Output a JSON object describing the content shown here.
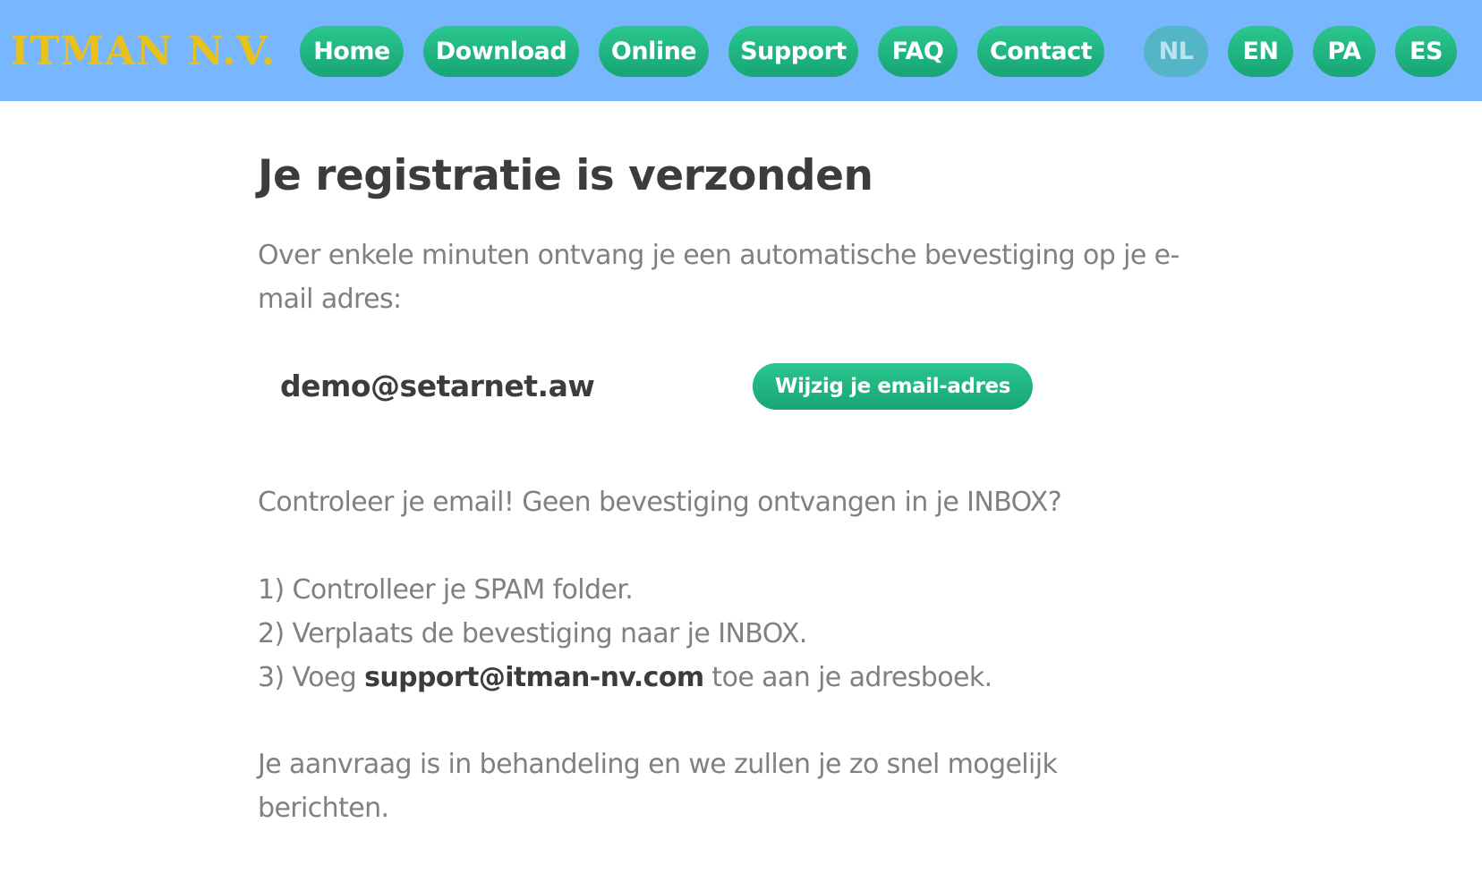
{
  "header": {
    "logo": "ITMAN N.V.",
    "nav": [
      {
        "label": "Home"
      },
      {
        "label": "Download"
      },
      {
        "label": "Online"
      },
      {
        "label": "Support"
      },
      {
        "label": "FAQ"
      },
      {
        "label": "Contact"
      }
    ],
    "languages": [
      {
        "label": "NL",
        "active": true
      },
      {
        "label": "EN",
        "active": false
      },
      {
        "label": "PA",
        "active": false
      },
      {
        "label": "ES",
        "active": false
      }
    ]
  },
  "main": {
    "title": "Je registratie is verzonden",
    "intro": "Over enkele minuten ontvang je een automatische bevestiging op je e-mail adres:",
    "email": "demo@setarnet.aw",
    "change_email_label": "Wijzig je email-adres",
    "check_text": "Controleer je email! Geen bevestiging ontvangen in je INBOX?",
    "steps": {
      "step1": "1) Controlleer je SPAM folder.",
      "step2": "2) Verplaats de bevestiging naar je INBOX.",
      "step3_prefix": "3) Voeg ",
      "step3_email": "support@itman-nv.com",
      "step3_suffix": " toe aan je adresboek."
    },
    "closing": "Je aanvraag is in behandeling en we zullen je zo snel mogelijk berichten."
  },
  "colors": {
    "header_bg": "#78b7fd",
    "logo": "#e8c21a",
    "button_green": "#1fb47f",
    "language_active": "#53b5c6",
    "heading_text": "#3c3c3c",
    "body_text": "#808080"
  }
}
